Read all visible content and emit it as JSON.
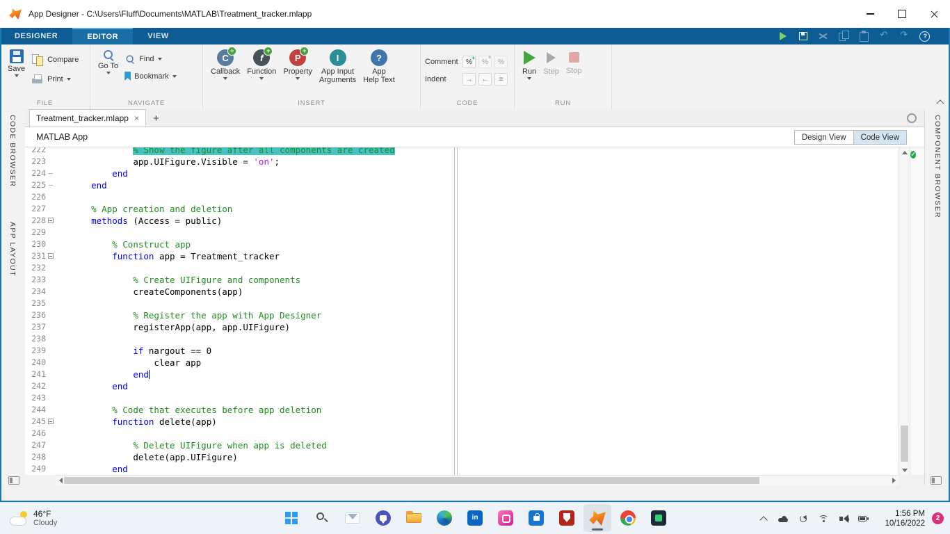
{
  "titlebar": {
    "title": "App Designer - C:\\Users\\Fluff\\Documents\\MATLAB\\Treatment_tracker.mlapp"
  },
  "toolstrip": {
    "tabs": [
      "DESIGNER",
      "EDITOR",
      "VIEW"
    ],
    "active_tab": "EDITOR",
    "quick_access": [
      {
        "name": "run"
      },
      {
        "name": "save"
      },
      {
        "name": "cut",
        "disabled": true
      },
      {
        "name": "copy",
        "disabled": true
      },
      {
        "name": "paste",
        "disabled": true
      },
      {
        "name": "undo",
        "disabled": true
      },
      {
        "name": "redo",
        "disabled": true
      },
      {
        "name": "help"
      }
    ],
    "sections": {
      "file": {
        "label": "FILE",
        "save": "Save",
        "compare": "Compare",
        "print": "Print"
      },
      "navigate": {
        "label": "NAVIGATE",
        "goto": "Go To",
        "find": "Find",
        "bookmark": "Bookmark"
      },
      "insert": {
        "label": "INSERT",
        "callback": "Callback",
        "function": "Function",
        "property": "Property",
        "app_input_line1": "App Input",
        "app_input_line2": "Arguments",
        "app_help_line1": "App",
        "app_help_line2": "Help Text"
      },
      "code": {
        "label": "CODE",
        "comment": "Comment",
        "indent": "Indent"
      },
      "run": {
        "label": "RUN",
        "run": "Run",
        "step": "Step",
        "stop": "Stop"
      }
    }
  },
  "panels": {
    "code_browser": "CODE BROWSER",
    "app_layout": "APP LAYOUT",
    "component_browser": "COMPONENT BROWSER"
  },
  "document": {
    "tab_title": "Treatment_tracker.mlapp",
    "type_label": "MATLAB App",
    "design_view": "Design View",
    "code_view": "Code View",
    "active_view": "Code View"
  },
  "editor": {
    "syntax_colors": {
      "keyword": "#0000FF",
      "comment": "#228B22",
      "string": "#A020F0",
      "default": "#000000",
      "selection_highlight": "#47C3C5"
    },
    "lines": [
      {
        "n": 222,
        "i": 12,
        "sel": true,
        "p": [
          [
            "c",
            "% Show the figure after all components are created"
          ]
        ]
      },
      {
        "n": 223,
        "i": 12,
        "p": [
          [
            "t",
            "app.UIFigure.Visible = "
          ],
          [
            "s",
            "'on'"
          ],
          [
            "t",
            ";"
          ]
        ]
      },
      {
        "n": 224,
        "i": 8,
        "f": "end",
        "p": [
          [
            "k",
            "end"
          ]
        ]
      },
      {
        "n": 225,
        "i": 4,
        "f": "end",
        "p": [
          [
            "k",
            "end"
          ]
        ]
      },
      {
        "n": 226,
        "i": 0,
        "p": []
      },
      {
        "n": 227,
        "i": 4,
        "p": [
          [
            "c",
            "% App creation and deletion"
          ]
        ]
      },
      {
        "n": 228,
        "i": 4,
        "f": "open",
        "p": [
          [
            "k",
            "methods"
          ],
          [
            "t",
            " (Access = public)"
          ]
        ]
      },
      {
        "n": 229,
        "i": 0,
        "p": []
      },
      {
        "n": 230,
        "i": 8,
        "p": [
          [
            "c",
            "% Construct app"
          ]
        ]
      },
      {
        "n": 231,
        "i": 8,
        "f": "open",
        "p": [
          [
            "k",
            "function"
          ],
          [
            "t",
            " app = Treatment_tracker"
          ]
        ]
      },
      {
        "n": 232,
        "i": 0,
        "p": []
      },
      {
        "n": 233,
        "i": 12,
        "p": [
          [
            "c",
            "% Create UIFigure and components"
          ]
        ]
      },
      {
        "n": 234,
        "i": 12,
        "p": [
          [
            "t",
            "createComponents(app)"
          ]
        ]
      },
      {
        "n": 235,
        "i": 0,
        "p": []
      },
      {
        "n": 236,
        "i": 12,
        "p": [
          [
            "c",
            "% Register the app with App Designer"
          ]
        ]
      },
      {
        "n": 237,
        "i": 12,
        "p": [
          [
            "t",
            "registerApp(app, app.UIFigure)"
          ]
        ]
      },
      {
        "n": 238,
        "i": 0,
        "p": []
      },
      {
        "n": 239,
        "i": 12,
        "p": [
          [
            "k",
            "if"
          ],
          [
            "t",
            " nargout == 0"
          ]
        ]
      },
      {
        "n": 240,
        "i": 16,
        "p": [
          [
            "t",
            "clear app"
          ]
        ]
      },
      {
        "n": 241,
        "i": 12,
        "caret": true,
        "p": [
          [
            "k",
            "end"
          ]
        ]
      },
      {
        "n": 242,
        "i": 8,
        "p": [
          [
            "k",
            "end"
          ]
        ]
      },
      {
        "n": 243,
        "i": 0,
        "p": []
      },
      {
        "n": 244,
        "i": 8,
        "p": [
          [
            "c",
            "% Code that executes before app deletion"
          ]
        ]
      },
      {
        "n": 245,
        "i": 8,
        "f": "open",
        "p": [
          [
            "k",
            "function"
          ],
          [
            "t",
            " delete(app)"
          ]
        ]
      },
      {
        "n": 246,
        "i": 0,
        "p": []
      },
      {
        "n": 247,
        "i": 12,
        "p": [
          [
            "c",
            "% Delete UIFigure when app is deleted"
          ]
        ]
      },
      {
        "n": 248,
        "i": 12,
        "p": [
          [
            "t",
            "delete(app.UIFigure)"
          ]
        ]
      },
      {
        "n": 249,
        "i": 8,
        "p": [
          [
            "k",
            "end"
          ]
        ]
      }
    ]
  },
  "taskbar": {
    "weather": {
      "temp": "46°F",
      "condition": "Cloudy"
    },
    "apps": [
      "start",
      "search",
      "mail",
      "teams",
      "file-explorer",
      "edge",
      "linkedin",
      "pink-app",
      "store",
      "shield-app",
      "matlab",
      "chrome",
      "dark-app"
    ],
    "active_app": "matlab",
    "tray": [
      "chevron-up",
      "cloud",
      "sync",
      "wifi",
      "volume",
      "battery"
    ],
    "clock": {
      "time": "1:56 PM",
      "date": "10/16/2022"
    },
    "notification_badge": "2"
  }
}
